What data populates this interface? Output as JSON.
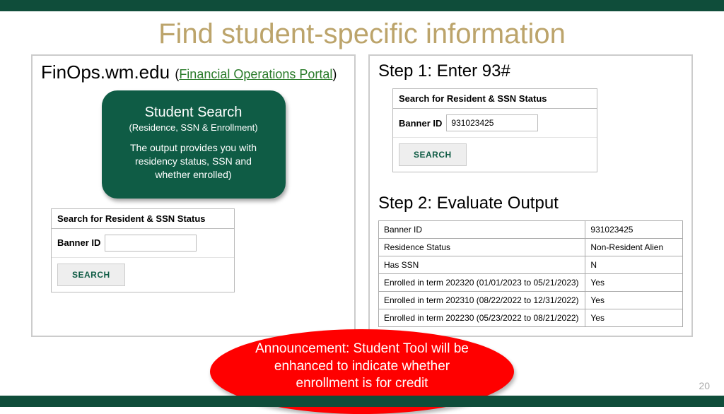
{
  "title": "Find student-specific information",
  "left": {
    "site": "FinOps.wm.edu",
    "link_open": "(",
    "link_text": "Financial Operations Portal",
    "link_close": ")",
    "badge_title": "Student Search",
    "badge_sub": "(Residence, SSN & Enrollment)",
    "badge_body": "The output provides you with residency status, SSN and whether enrolled)",
    "search_head": "Search for Resident & SSN Status",
    "bannerid_label": "Banner ID",
    "bannerid_value": "",
    "search_btn": "SEARCH"
  },
  "right": {
    "step1": "Step 1: Enter 93#",
    "search_head": "Search for Resident & SSN Status",
    "bannerid_label": "Banner ID",
    "bannerid_value": "931023425",
    "search_btn": "SEARCH",
    "step2": "Step 2: Evaluate Output",
    "rows": [
      {
        "k": "Banner ID",
        "v": "931023425"
      },
      {
        "k": "Residence Status",
        "v": "Non-Resident Alien"
      },
      {
        "k": "Has SSN",
        "v": "N"
      },
      {
        "k": "Enrolled in term 202320 (01/01/2023 to 05/21/2023)",
        "v": "Yes"
      },
      {
        "k": "Enrolled in term 202310 (08/22/2022 to 12/31/2022)",
        "v": "Yes"
      },
      {
        "k": "Enrolled in term 202230 (05/23/2022 to 08/21/2022)",
        "v": "Yes"
      }
    ]
  },
  "announce": "Announcement:  Student Tool will be enhanced to indicate whether enrollment is for credit",
  "page_number": "20"
}
